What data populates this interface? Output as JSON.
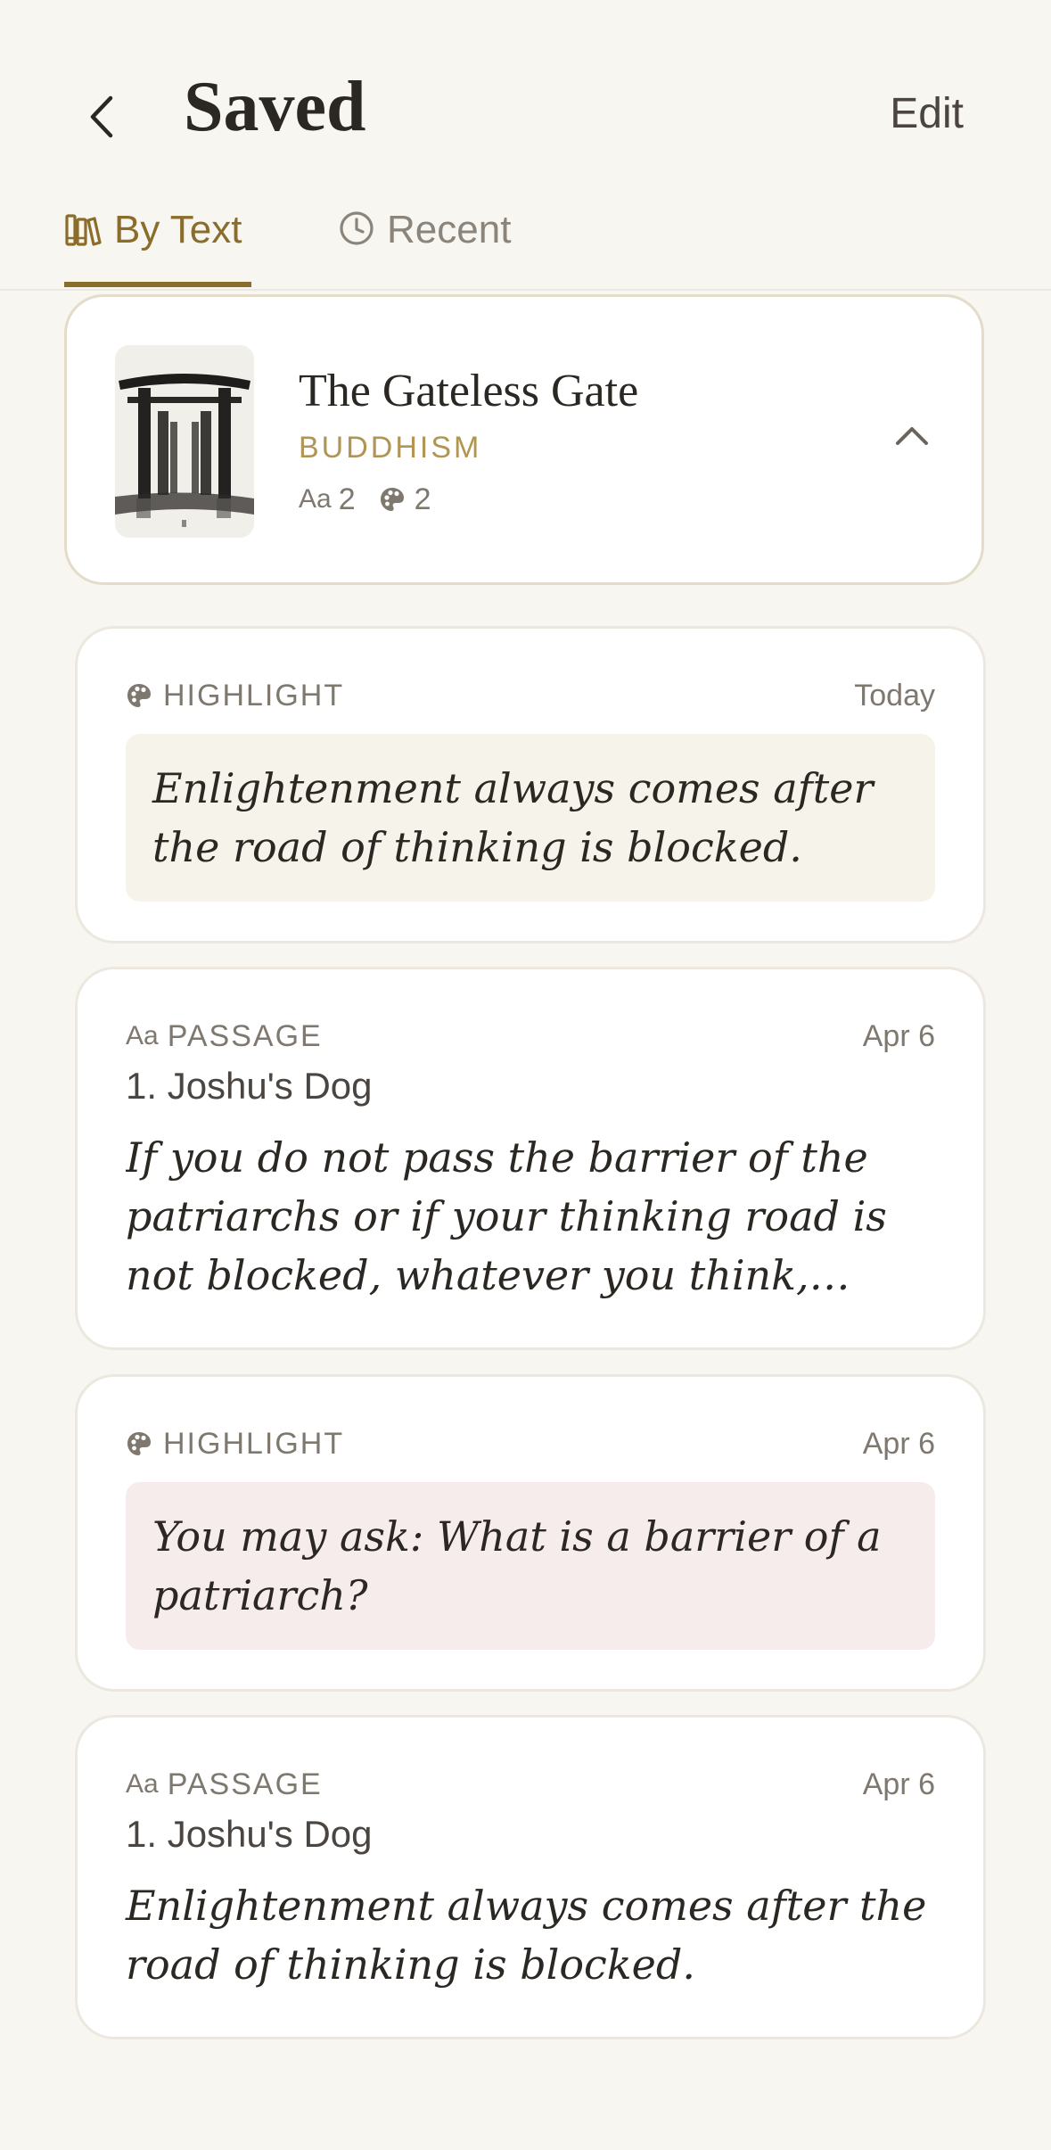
{
  "header": {
    "title": "Saved",
    "edit_label": "Edit"
  },
  "tabs": [
    {
      "label": "By Text",
      "icon": "books-icon",
      "active": true
    },
    {
      "label": "Recent",
      "icon": "clock-icon",
      "active": false
    }
  ],
  "book": {
    "title": "The Gateless Gate",
    "tradition": "BUDDHISM",
    "passage_count": "2",
    "highlight_count": "2",
    "expanded": true
  },
  "items": [
    {
      "type_label": "HIGHLIGHT",
      "date": "Today",
      "text": "Enlightenment always comes after the road of thinking is blocked.",
      "color": "#f5f3ea"
    },
    {
      "type_label": "PASSAGE",
      "date": "Apr 6",
      "section": "1. Joshu's Dog",
      "text": "If you do not pass the barrier of the patriarchs or if your thinking road is not blocked, whatever you think, whatever you do, is like a tangling ghost."
    },
    {
      "type_label": "HIGHLIGHT",
      "date": "Apr 6",
      "text": "You may ask: What is a barrier of a patriarch?",
      "color": "#f7ecec"
    },
    {
      "type_label": "PASSAGE",
      "date": "Apr 6",
      "section": "1. Joshu's Dog",
      "text": "Enlightenment always comes after the road of thinking is blocked."
    }
  ],
  "colors": {
    "accent": "#8a6d2a",
    "tradition": "#b09554",
    "background": "#f8f6f0"
  }
}
